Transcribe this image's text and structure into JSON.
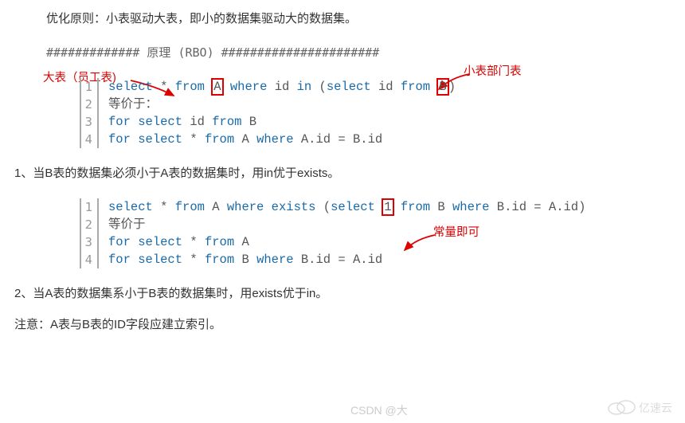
{
  "principle": "优化原则：小表驱动大表，即小的数据集驱动大的数据集。",
  "heading": {
    "left_hashes": "#############",
    "title": " 原理 (RBO) ",
    "right_hashes": "######################"
  },
  "labels": {
    "big_table": "大表（员工表)",
    "small_table": "小表部门表",
    "constant": "常量即可"
  },
  "code1": {
    "line_nums": [
      "1",
      "2",
      "3",
      "4"
    ],
    "l1": {
      "select": "select",
      "star": " * ",
      "from1": "from",
      "A": "A",
      "where": "where",
      "id_in": " id ",
      "in": "in",
      "open": " (",
      "select2": "select",
      "id": " id ",
      "from2": "from",
      "B": "B",
      "close": ")"
    },
    "l2": "等价于：",
    "l3": {
      "for": "for",
      "select": "select",
      "rest": " id ",
      "from": "from",
      "rest2": " B"
    },
    "l4": {
      "for": "for",
      "select": "select",
      "star": " * ",
      "from": "from",
      "A_where": " A ",
      "where": "where",
      "rest": " A.id = B.id"
    }
  },
  "point1": "1、当B表的数据集必须小于A表的数据集时，用in优于exists。",
  "code2": {
    "line_nums": [
      "1",
      "2",
      "3",
      "4"
    ],
    "l1": {
      "select": "select",
      "star": " * ",
      "from": "from",
      "A_w": " A ",
      "where": "where",
      "sp": " ",
      "exists": "exists",
      "open": " (",
      "select2": "select",
      "sp2": " ",
      "one": "1",
      "sp3": " ",
      "from2": "from",
      "Bw": " B ",
      "where2": "where",
      "cond": " B.id = A.id)"
    },
    "l2": "等价于",
    "l3": {
      "for": "for",
      "select": "select",
      "star": " * ",
      "from": "from",
      "A": " A"
    },
    "l4": {
      "for": "for",
      "select": "select",
      "star": " * ",
      "from": "from",
      "Bw": " B ",
      "where": "where",
      "cond": " B.id = A.id"
    }
  },
  "point2": "2、当A表的数据集系小于B表的数据集时，用exists优于in。",
  "note": "注意：A表与B表的ID字段应建立索引。",
  "watermark": {
    "csdn": "CSDN @大",
    "logo": "亿速云"
  }
}
